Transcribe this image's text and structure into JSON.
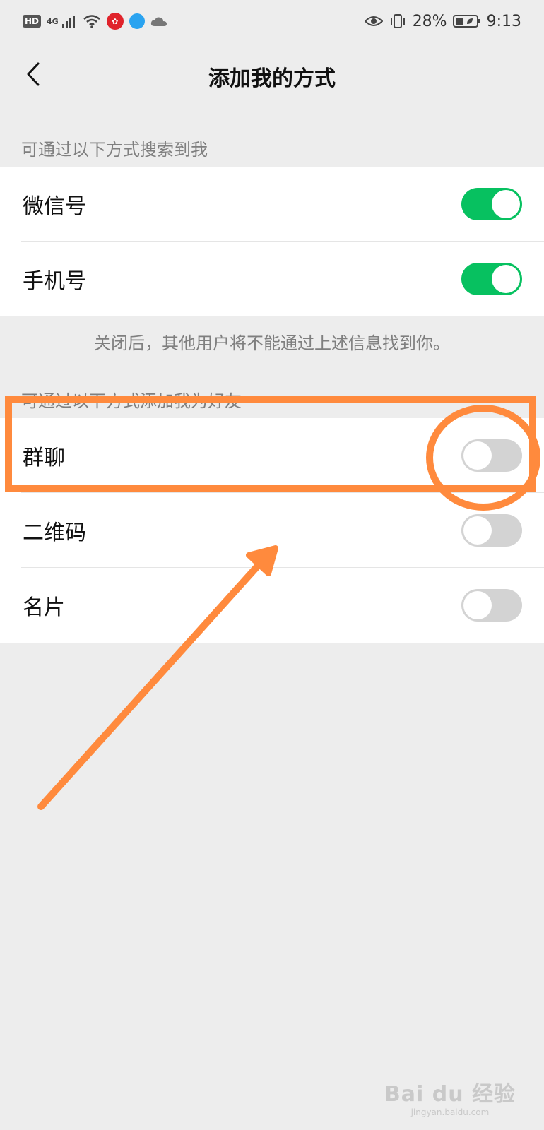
{
  "status_bar": {
    "hd": "HD",
    "network": "4G",
    "battery": "28%",
    "time": "9:13"
  },
  "nav": {
    "title": "添加我的方式"
  },
  "search_section": {
    "header": "可通过以下方式搜索到我",
    "items": [
      {
        "label": "微信号",
        "enabled": true
      },
      {
        "label": "手机号",
        "enabled": true
      }
    ],
    "footnote": "关闭后，其他用户将不能通过上述信息找到你。"
  },
  "add_section": {
    "header": "可通过以下方式添加我为好友",
    "items": [
      {
        "label": "群聊",
        "enabled": false
      },
      {
        "label": "二维码",
        "enabled": false
      },
      {
        "label": "名片",
        "enabled": false
      }
    ]
  },
  "annotation": {
    "color": "#ff8a3d"
  },
  "watermark": {
    "brand": "Bai du 经验",
    "url": "jingyan.baidu.com"
  },
  "colors": {
    "switch_on": "#07c160",
    "switch_off": "#d3d3d3",
    "background": "#ededed"
  }
}
